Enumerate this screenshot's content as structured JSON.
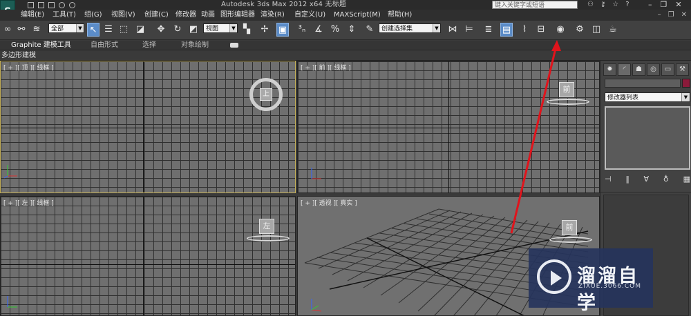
{
  "app": {
    "logo_letter": "S",
    "title": "Autodesk 3ds Max  2012 x64    无标题",
    "search_placeholder": "键入关键字或短语"
  },
  "menus": [
    "编辑(E)",
    "工具(T)",
    "组(G)",
    "视图(V)",
    "创建(C)",
    "修改器",
    "动画",
    "图形编辑器",
    "渲染(R)",
    "自定义(U)",
    "MAXScript(M)",
    "帮助(H)"
  ],
  "toolbar": {
    "selection_filter": "全部",
    "reference_coord": "视图",
    "named_selection": "创建选择集"
  },
  "ribbon": {
    "tabs": [
      "Graphite 建模工具",
      "自由形式",
      "选择",
      "对象绘制"
    ],
    "active_tab": "Graphite 建模工具",
    "sub_label": "多边形建模"
  },
  "viewports": {
    "top": {
      "label": "[ + ][ 顶 ][ 线框 ]",
      "cube_face": "上"
    },
    "front": {
      "label": "[ + ][ 前 ][ 线框 ]",
      "cube_face": "前"
    },
    "left": {
      "label": "[ + ][ 左 ][ 线框 ]",
      "cube_face": "左"
    },
    "perspective": {
      "label": "[ + ][ 透视 ][ 真实 ]",
      "cube_face": "前"
    }
  },
  "command_panel": {
    "modifier_list": "修改器列表",
    "name_field": "",
    "object_color": "#8b1a3a"
  },
  "watermark": {
    "title": "溜溜自学",
    "subtitle": "ZIXUE.3066.COM"
  },
  "annotation_color": "#e0141c"
}
